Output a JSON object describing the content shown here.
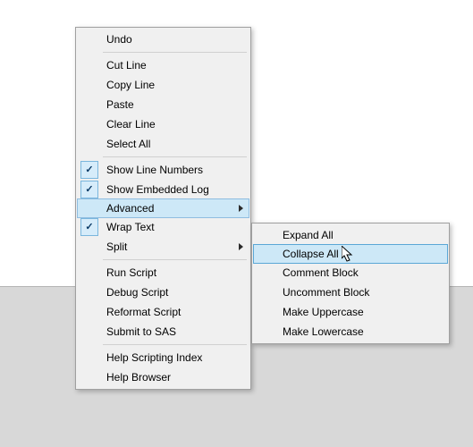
{
  "main_menu": {
    "groups": [
      [
        {
          "label": "Undo",
          "checked": false,
          "submenu": false
        }
      ],
      [
        {
          "label": "Cut Line",
          "checked": false,
          "submenu": false
        },
        {
          "label": "Copy Line",
          "checked": false,
          "submenu": false
        },
        {
          "label": "Paste",
          "checked": false,
          "submenu": false
        },
        {
          "label": "Clear Line",
          "checked": false,
          "submenu": false
        },
        {
          "label": "Select All",
          "checked": false,
          "submenu": false
        }
      ],
      [
        {
          "label": "Show Line Numbers",
          "checked": true,
          "submenu": false
        },
        {
          "label": "Show Embedded Log",
          "checked": true,
          "submenu": false
        },
        {
          "label": "Advanced",
          "checked": false,
          "submenu": true,
          "open": true
        },
        {
          "label": "Wrap Text",
          "checked": true,
          "submenu": false
        },
        {
          "label": "Split",
          "checked": false,
          "submenu": true
        }
      ],
      [
        {
          "label": "Run Script",
          "checked": false,
          "submenu": false
        },
        {
          "label": "Debug Script",
          "checked": false,
          "submenu": false
        },
        {
          "label": "Reformat Script",
          "checked": false,
          "submenu": false
        },
        {
          "label": "Submit to SAS",
          "checked": false,
          "submenu": false
        }
      ],
      [
        {
          "label": "Help Scripting Index",
          "checked": false,
          "submenu": false
        },
        {
          "label": "Help Browser",
          "checked": false,
          "submenu": false
        }
      ]
    ]
  },
  "sub_menu": {
    "items": [
      {
        "label": "Expand All",
        "selected": false
      },
      {
        "label": "Collapse All",
        "selected": true
      },
      {
        "label": "Comment Block",
        "selected": false
      },
      {
        "label": "Uncomment Block",
        "selected": false
      },
      {
        "label": "Make Uppercase",
        "selected": false
      },
      {
        "label": "Make Lowercase",
        "selected": false
      }
    ]
  }
}
